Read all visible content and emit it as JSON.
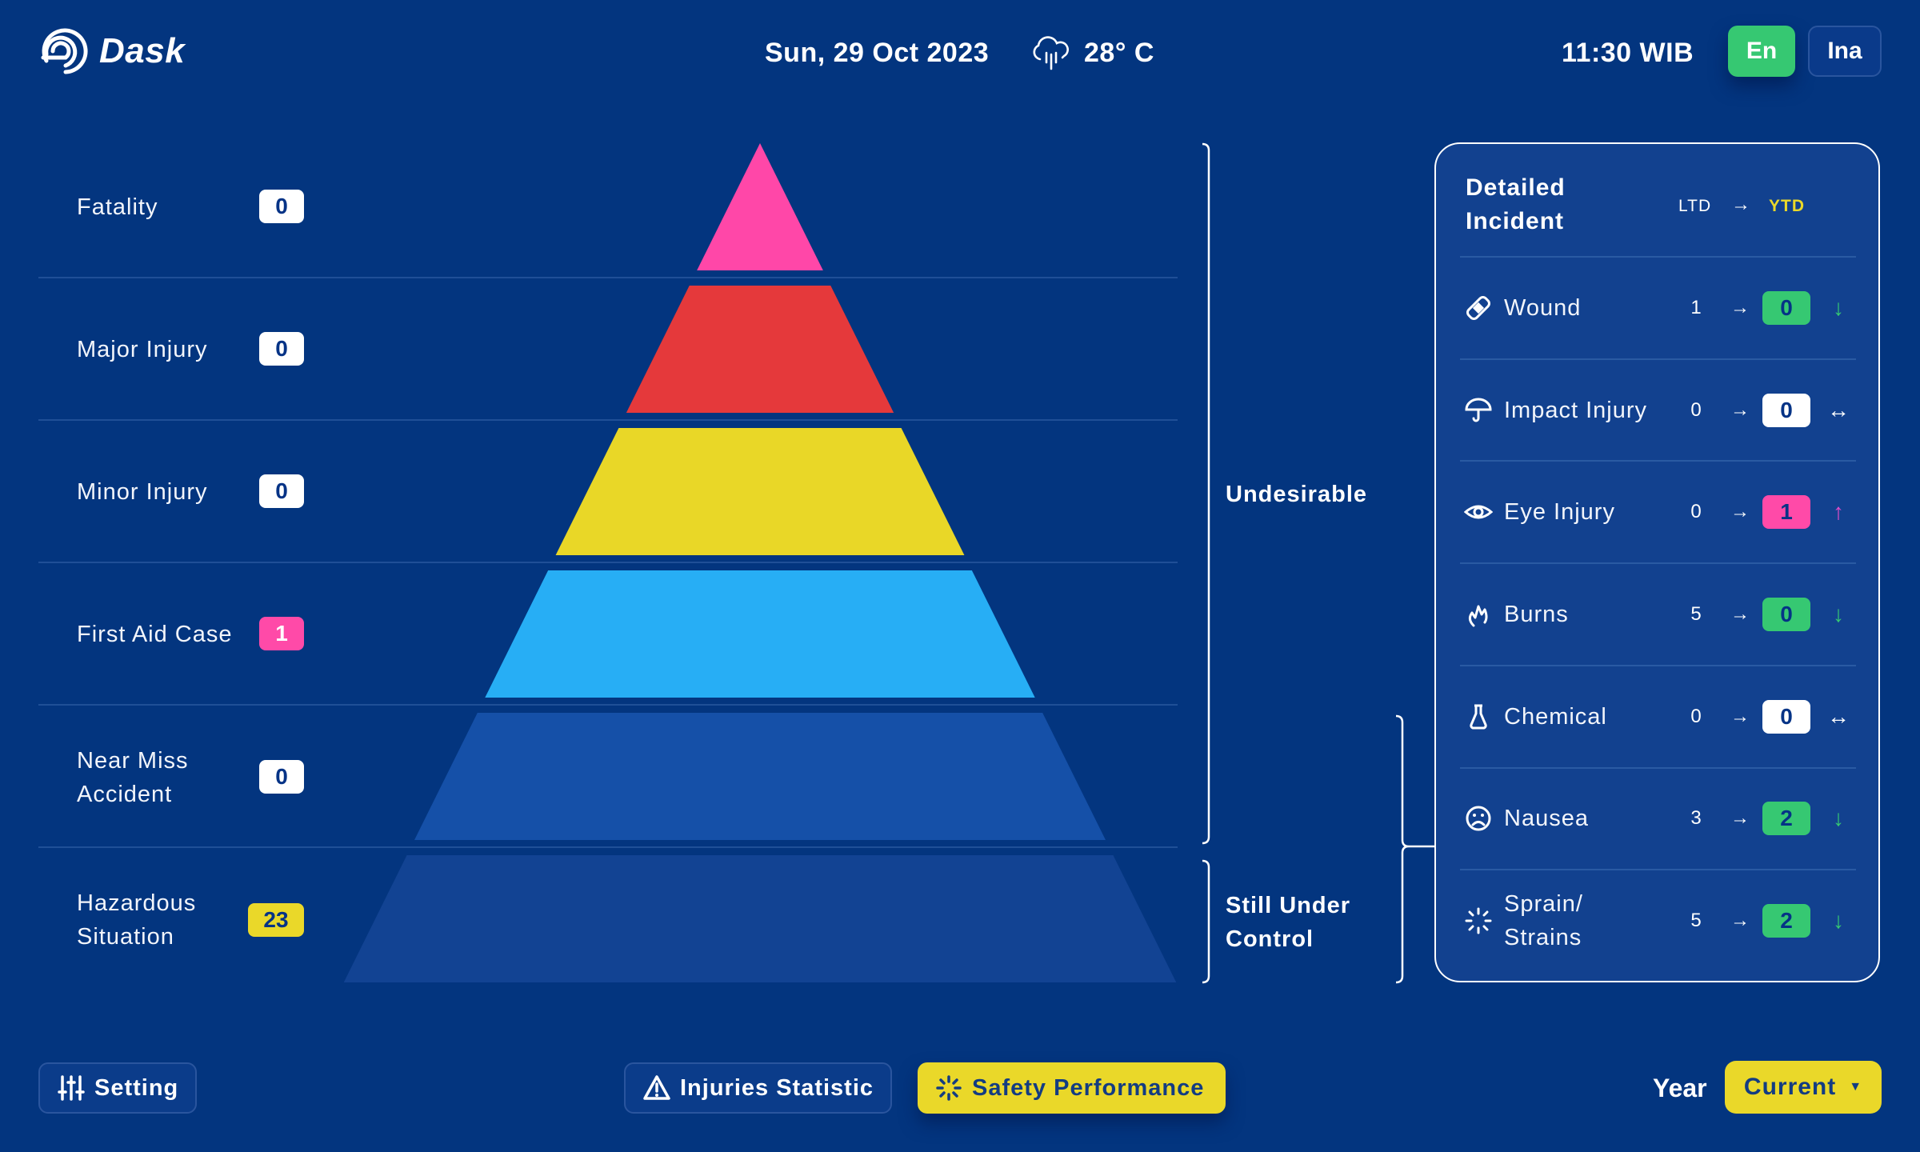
{
  "header": {
    "brand": "Dask",
    "date": "Sun, 29 Oct 2023",
    "weather_icon": "cloud-rain-icon",
    "temperature": "28° C",
    "time": "11:30 WIB",
    "languages": [
      {
        "label": "En",
        "active": true
      },
      {
        "label": "Ina",
        "active": false
      }
    ]
  },
  "pyramid": {
    "levels": [
      {
        "label": "Fatality",
        "count": "0",
        "badge_color": "white",
        "fill": "#ff47a8"
      },
      {
        "label": "Major Injury",
        "count": "0",
        "badge_color": "white",
        "fill": "#e5393b"
      },
      {
        "label": "Minor Injury",
        "count": "0",
        "badge_color": "white",
        "fill": "#e9d727"
      },
      {
        "label": "First Aid Case",
        "count": "1",
        "badge_color": "pink",
        "fill": "#27aef5"
      },
      {
        "label_lines": [
          "Near Miss",
          "Accident"
        ],
        "count": "0",
        "badge_color": "white",
        "fill": "#1550a8"
      },
      {
        "label_lines": [
          "Hazardous",
          "Situation"
        ],
        "count": "23",
        "badge_color": "yellow",
        "fill": "#124393"
      }
    ],
    "groups": [
      {
        "label": "Undesirable"
      },
      {
        "label_lines": [
          "Still Under",
          "Control"
        ]
      }
    ]
  },
  "panel": {
    "title_lines": [
      "Detailed",
      "Incident"
    ],
    "col_ltd": "LTD",
    "col_arrow": "→",
    "col_ytd": "YTD",
    "rows": [
      {
        "icon": "bandage-icon",
        "label": "Wound",
        "ltd": "1",
        "ytd": "0",
        "ytd_color": "green",
        "trend": "↓",
        "trend_name": "trend-down-icon",
        "trend_color": "#36c872"
      },
      {
        "icon": "umbrella-icon",
        "label": "Impact Injury",
        "ltd": "0",
        "ytd": "0",
        "ytd_color": "white",
        "trend": "↔",
        "trend_name": "trend-flat-icon",
        "trend_color": "#ffffff"
      },
      {
        "icon": "eye-icon",
        "label": "Eye Injury",
        "ltd": "0",
        "ytd": "1",
        "ytd_color": "pink",
        "trend": "↑",
        "trend_name": "trend-up-icon",
        "trend_color": "#e24cc8"
      },
      {
        "icon": "flame-icon",
        "label": "Burns",
        "ltd": "5",
        "ytd": "0",
        "ytd_color": "green",
        "trend": "↓",
        "trend_name": "trend-down-icon",
        "trend_color": "#36c872"
      },
      {
        "icon": "flask-icon",
        "label": "Chemical",
        "ltd": "0",
        "ytd": "0",
        "ytd_color": "white",
        "trend": "↔",
        "trend_name": "trend-flat-icon",
        "trend_color": "#ffffff"
      },
      {
        "icon": "sad-face-icon",
        "label": "Nausea",
        "ltd": "3",
        "ytd": "2",
        "ytd_color": "green",
        "trend": "↓",
        "trend_name": "trend-down-icon",
        "trend_color": "#36c872"
      },
      {
        "icon": "burst-icon",
        "label_lines": [
          "Sprain/",
          "Strains"
        ],
        "ltd": "5",
        "ytd": "2",
        "ytd_color": "green",
        "trend": "↓",
        "trend_name": "trend-down-icon",
        "trend_color": "#36c872"
      }
    ]
  },
  "footer": {
    "setting_label": "Setting",
    "injuries_label": "Injuries Statistic",
    "safety_label": "Safety Performance",
    "year_label": "Year",
    "year_value": "Current"
  }
}
